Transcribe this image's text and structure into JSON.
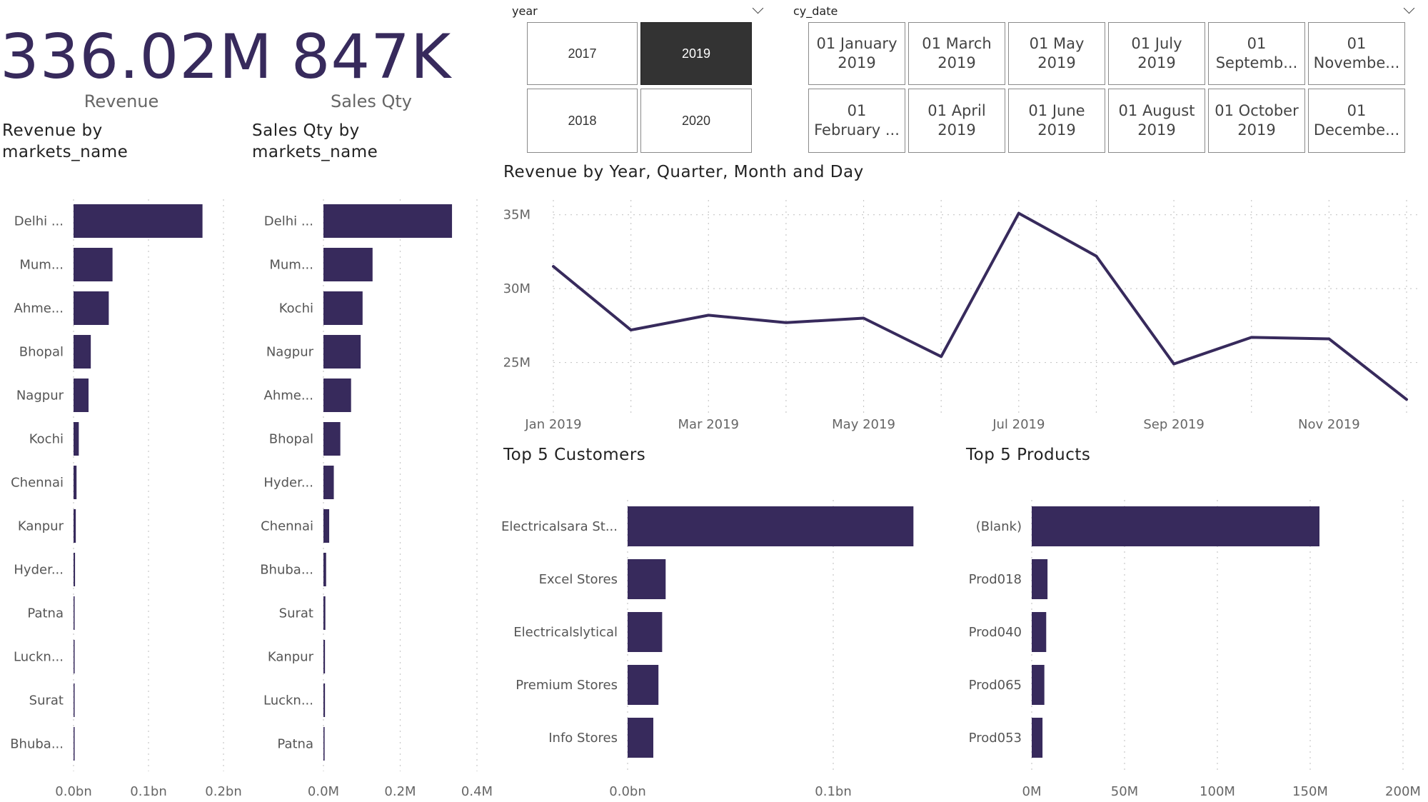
{
  "kpis": {
    "revenue": {
      "value": "336.02M",
      "label": "Revenue"
    },
    "sales_qty": {
      "value": "847K",
      "label": "Sales Qty"
    }
  },
  "slicers": {
    "year": {
      "header": "year",
      "options": [
        {
          "label": "2017",
          "selected": false
        },
        {
          "label": "2019",
          "selected": true
        },
        {
          "label": "2018",
          "selected": false
        },
        {
          "label": "2020",
          "selected": false
        }
      ]
    },
    "cy_date": {
      "header": "cy_date",
      "options": [
        "01 January 2019",
        "01 March 2019",
        "01 May 2019",
        "01 July 2019",
        "01 Septemb...",
        "01 Novembe...",
        "01 February ...",
        "01 April 2019",
        "01 June 2019",
        "01 August 2019",
        "01 October 2019",
        "01 Decembe..."
      ]
    }
  },
  "colors": {
    "bar": "#372a5c",
    "line": "#372a5c",
    "grid": "#c8c8c8",
    "selected_tile": "#333333"
  },
  "chart_data": [
    {
      "id": "revenue_by_market",
      "type": "bar",
      "orientation": "horizontal",
      "title": "Revenue by markets_name",
      "title_lines": [
        "Revenue by",
        "markets_name"
      ],
      "categories": [
        "Delhi ...",
        "Mum...",
        "Ahme...",
        "Bhopal",
        "Nagpur",
        "Kochi",
        "Chennai",
        "Kanpur",
        "Hyder...",
        "Patna",
        "Luckn...",
        "Surat",
        "Bhuba..."
      ],
      "values": [
        0.172,
        0.052,
        0.047,
        0.023,
        0.02,
        0.007,
        0.004,
        0.003,
        0.002,
        0.001,
        0.001,
        0.001,
        0.0005
      ],
      "xlim": [
        0,
        0.2
      ],
      "ticks": [
        0,
        0.1,
        0.2
      ],
      "tick_labels": [
        "0.0bn",
        "0.1bn",
        "0.2bn"
      ],
      "grid": true
    },
    {
      "id": "sales_qty_by_market",
      "type": "bar",
      "orientation": "horizontal",
      "title": "Sales Qty by markets_name",
      "title_lines": [
        "Sales Qty by",
        "markets_name"
      ],
      "categories": [
        "Delhi ...",
        "Mum...",
        "Kochi",
        "Nagpur",
        "Ahme...",
        "Bhopal",
        "Hyder...",
        "Chennai",
        "Bhuba...",
        "Surat",
        "Kanpur",
        "Luckn...",
        "Patna"
      ],
      "values": [
        0.335,
        0.128,
        0.102,
        0.097,
        0.072,
        0.044,
        0.027,
        0.015,
        0.007,
        0.005,
        0.004,
        0.004,
        0.003
      ],
      "xlim": [
        0,
        0.4
      ],
      "ticks": [
        0,
        0.2,
        0.4
      ],
      "tick_labels": [
        "0.0M",
        "0.2M",
        "0.4M"
      ],
      "grid": true
    },
    {
      "id": "revenue_trend",
      "type": "line",
      "title": "Revenue by Year, Quarter, Month and Day",
      "x": [
        "2019-01",
        "2019-02",
        "2019-03",
        "2019-04",
        "2019-05",
        "2019-06",
        "2019-07",
        "2019-08",
        "2019-09",
        "2019-10",
        "2019-11",
        "2019-12"
      ],
      "values": [
        31.5,
        27.2,
        28.2,
        27.7,
        28.0,
        25.4,
        35.1,
        32.2,
        24.9,
        26.7,
        26.6,
        22.5
      ],
      "x_tick_labels": [
        "Jan 2019",
        "Mar 2019",
        "May 2019",
        "Jul 2019",
        "Sep 2019",
        "Nov 2019"
      ],
      "y_ticks": [
        25,
        30,
        35
      ],
      "y_tick_labels": [
        "25M",
        "30M",
        "35M"
      ],
      "ylim": [
        21.5,
        36
      ],
      "grid": true
    },
    {
      "id": "top5_customers",
      "type": "bar",
      "orientation": "horizontal",
      "title": "Top 5 Customers",
      "categories": [
        "Electricalsara St...",
        "Excel Stores",
        "Electricalslytical",
        "Premium Stores",
        "Info Stores"
      ],
      "values": [
        0.139,
        0.0185,
        0.0168,
        0.015,
        0.0125
      ],
      "xlim": [
        0,
        0.15
      ],
      "ticks": [
        0,
        0.1
      ],
      "tick_labels": [
        "0.0bn",
        "0.1bn"
      ],
      "grid": true
    },
    {
      "id": "top5_products",
      "type": "bar",
      "orientation": "horizontal",
      "title": "Top 5 Products",
      "categories": [
        "(Blank)",
        "Prod018",
        "Prod040",
        "Prod065",
        "Prod053"
      ],
      "values": [
        155,
        8.5,
        7.8,
        6.8,
        5.8
      ],
      "xlim": [
        0,
        200
      ],
      "ticks": [
        0,
        50,
        100,
        150,
        200
      ],
      "tick_labels": [
        "0M",
        "50M",
        "100M",
        "150M",
        "200M"
      ],
      "grid": true
    }
  ]
}
